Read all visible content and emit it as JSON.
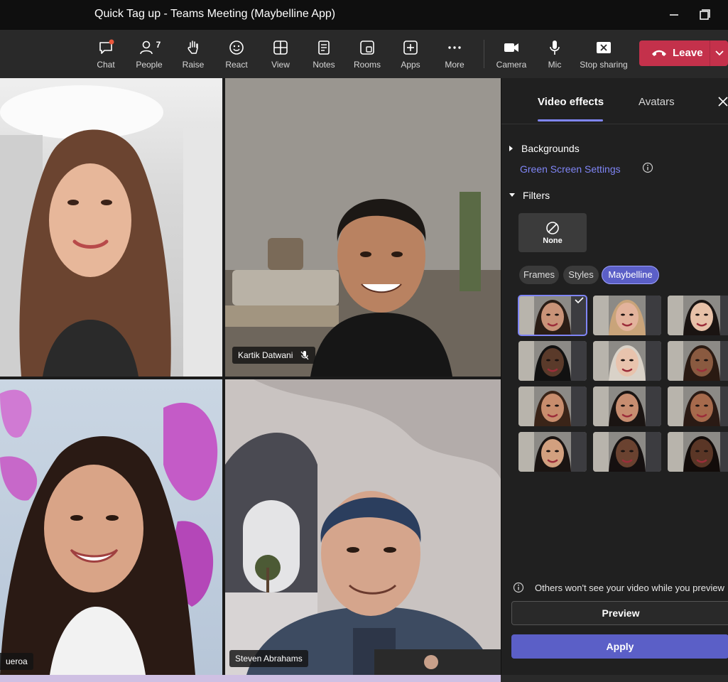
{
  "window": {
    "title": "Quick Tag up - Teams Meeting (Maybelline App)"
  },
  "toolbar": {
    "items": [
      {
        "label": "Chat",
        "icon": "chat-icon"
      },
      {
        "label": "People",
        "icon": "people-icon",
        "count": "7"
      },
      {
        "label": "Raise",
        "icon": "raise-hand-icon"
      },
      {
        "label": "React",
        "icon": "react-icon"
      },
      {
        "label": "View",
        "icon": "view-icon"
      },
      {
        "label": "Notes",
        "icon": "notes-icon"
      },
      {
        "label": "Rooms",
        "icon": "rooms-icon"
      },
      {
        "label": "Apps",
        "icon": "apps-icon"
      },
      {
        "label": "More",
        "icon": "more-icon"
      },
      {
        "label": "Camera",
        "icon": "camera-icon"
      },
      {
        "label": "Mic",
        "icon": "mic-icon"
      },
      {
        "label": "Stop sharing",
        "icon": "stop-sharing-icon"
      }
    ],
    "leave_label": "Leave"
  },
  "stage": {
    "tiles": [
      {
        "name": ""
      },
      {
        "name": "Kartik Datwani"
      },
      {
        "name": "ueroa"
      },
      {
        "name": "Steven Abrahams"
      }
    ]
  },
  "panel": {
    "tabs": [
      "Video effects",
      "Avatars"
    ],
    "backgrounds_label": "Backgrounds",
    "green_screen_link": "Green Screen Settings",
    "filters_label": "Filters",
    "none_label": "None",
    "chips": [
      "Frames",
      "Styles",
      "Maybelline"
    ],
    "notice": "Others won't see your video while you preview",
    "preview_label": "Preview",
    "apply_label": "Apply"
  },
  "colors": {
    "accent": "#7f85f5",
    "leave": "#c4314b",
    "apply": "#5b5fc7"
  }
}
